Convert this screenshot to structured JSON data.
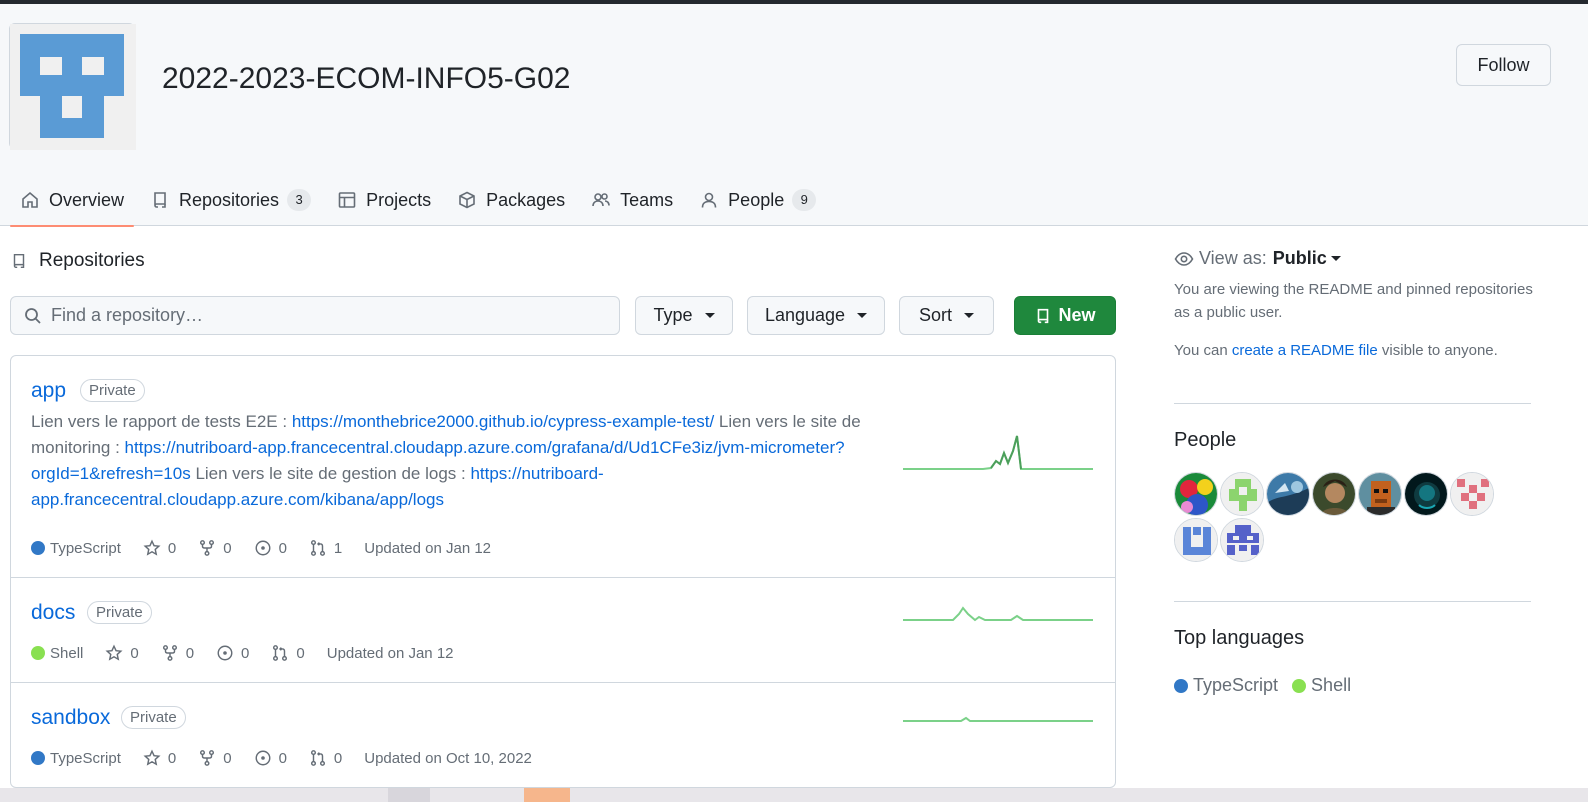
{
  "org": {
    "name": "2022-2023-ECOM-INFO5-G02",
    "follow_label": "Follow",
    "avatar_color": "#5a9bd5"
  },
  "nav": {
    "overview": "Overview",
    "repositories": "Repositories",
    "repositories_count": "3",
    "projects": "Projects",
    "packages": "Packages",
    "teams": "Teams",
    "people": "People",
    "people_count": "9"
  },
  "repos_section": {
    "title": "Repositories",
    "search_placeholder": "Find a repository…",
    "type_label": "Type",
    "language_label": "Language",
    "sort_label": "Sort",
    "new_label": "New"
  },
  "repos": [
    {
      "name": "app",
      "visibility": "Private",
      "desc_1": "Lien vers le rapport de tests E2E : ",
      "link_1": "https://monthebrice2000.github.io/cypress-example-test/",
      "desc_2": " Lien vers le site de monitoring : ",
      "link_2": "https://nutriboard-app.francecentral.cloudapp.azure.com/grafana/d/Ud1CFe3iz/jvm-micrometer?orgId=1&refresh=10s",
      "desc_3": " Lien vers le site de gestion de logs : ",
      "link_3": "https://nutriboard-app.francecentral.cloudapp.azure.com/kibana/app/logs",
      "language": "TypeScript",
      "language_color": "#3178c6",
      "stars": "0",
      "forks": "0",
      "issues": "0",
      "pulls": "1",
      "updated": "Updated on Jan 12"
    },
    {
      "name": "docs",
      "visibility": "Private",
      "language": "Shell",
      "language_color": "#89e051",
      "stars": "0",
      "forks": "0",
      "issues": "0",
      "pulls": "0",
      "updated": "Updated on Jan 12"
    },
    {
      "name": "sandbox",
      "visibility": "Private",
      "language": "TypeScript",
      "language_color": "#3178c6",
      "stars": "0",
      "forks": "0",
      "issues": "0",
      "pulls": "0",
      "updated": "Updated on Oct 10, 2022"
    }
  ],
  "sidebar": {
    "view_as_label": "View as:",
    "view_as_value": "Public",
    "note": "You are viewing the README and pinned repositories as a public user.",
    "note2_prefix": "You can ",
    "note2_link": "create a README file",
    "note2_suffix": " visible to anyone.",
    "people_title": "People",
    "top_languages_title": "Top languages",
    "languages": [
      {
        "name": "TypeScript",
        "color": "#3178c6"
      },
      {
        "name": "Shell",
        "color": "#89e051"
      }
    ]
  },
  "colors": {
    "accent": "#0969da",
    "primary_button": "#1f883d",
    "active_tab_underline": "#fd8c73",
    "sparkline": "#7bd189"
  }
}
